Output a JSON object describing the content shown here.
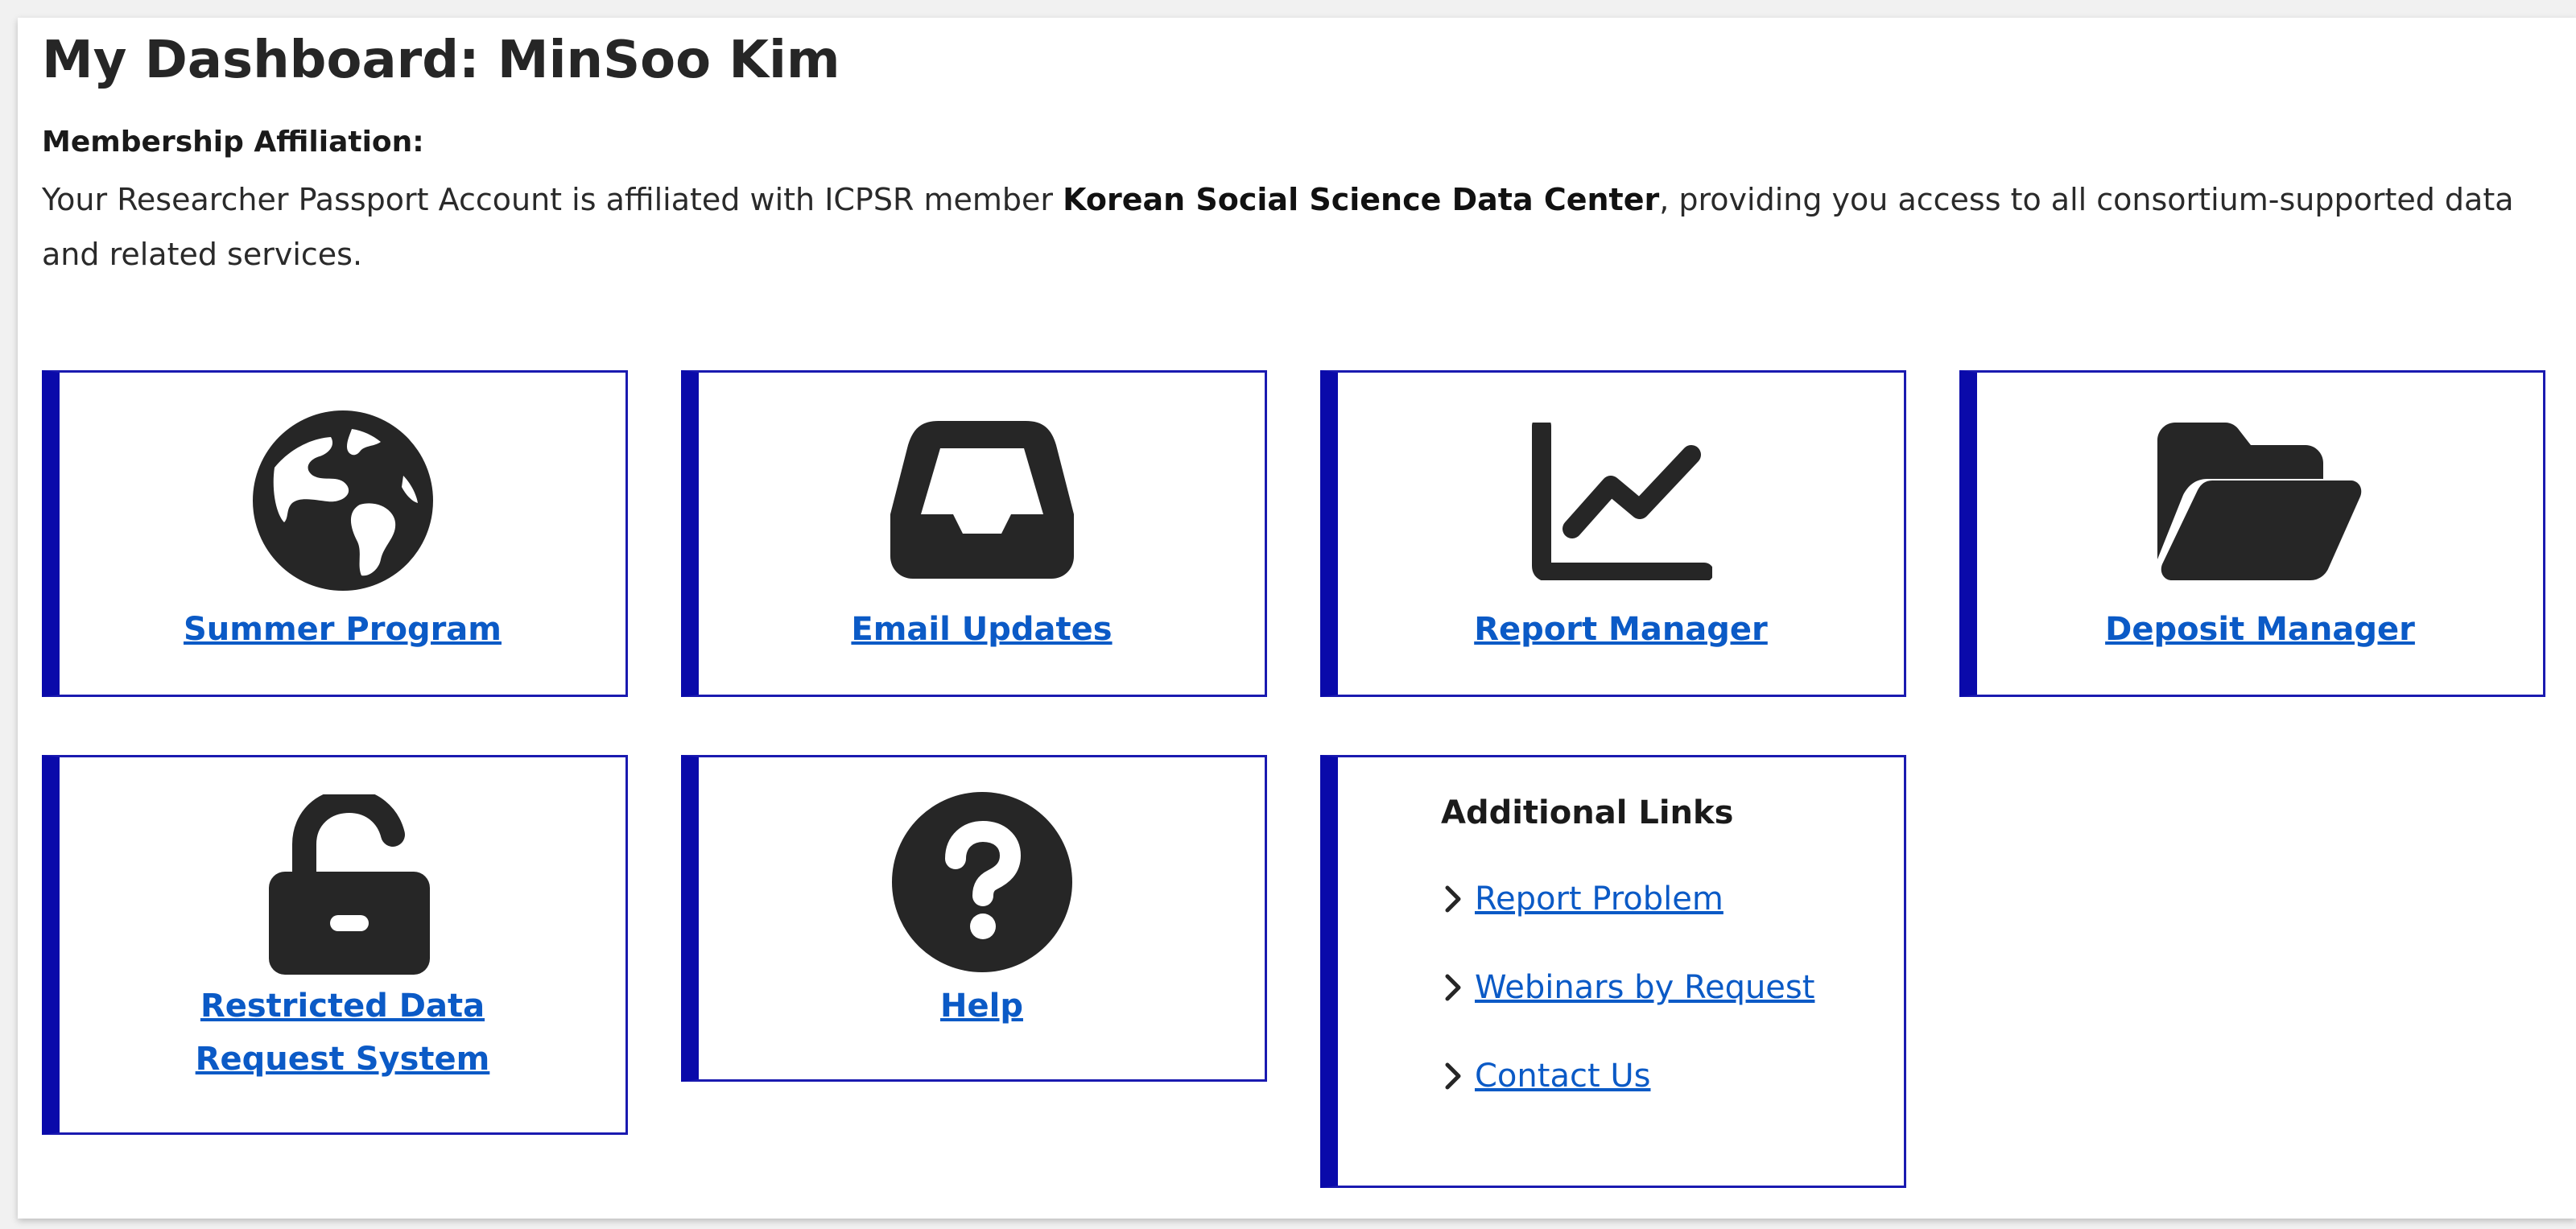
{
  "dashboard": {
    "title": "My Dashboard: MinSoo Kim",
    "affiliation_heading": "Membership Affiliation:",
    "affiliation_prefix": "Your Researcher Passport Account is affiliated with ICPSR member ",
    "affiliation_member": "Korean Social Science Data Center",
    "affiliation_suffix": ", providing you access to all consortium-supported data and related services."
  },
  "cards": [
    {
      "label": "Summer Program",
      "icon": "globe-icon"
    },
    {
      "label": "Email Updates",
      "icon": "inbox-icon"
    },
    {
      "label": "Report Manager",
      "icon": "chart-line-icon"
    },
    {
      "label": "Deposit Manager",
      "icon": "folder-open-icon"
    },
    {
      "label": "Restricted Data Request System",
      "icon": "unlock-icon"
    },
    {
      "label": "Help",
      "icon": "question-circle-icon"
    }
  ],
  "additional_links": {
    "heading": "Additional Links",
    "items": [
      "Report Problem",
      "Webinars by Request",
      "Contact Us"
    ]
  },
  "colors": {
    "card_accent": "#0a0aaa",
    "link": "#0b5ac6",
    "icon": "#262626"
  }
}
